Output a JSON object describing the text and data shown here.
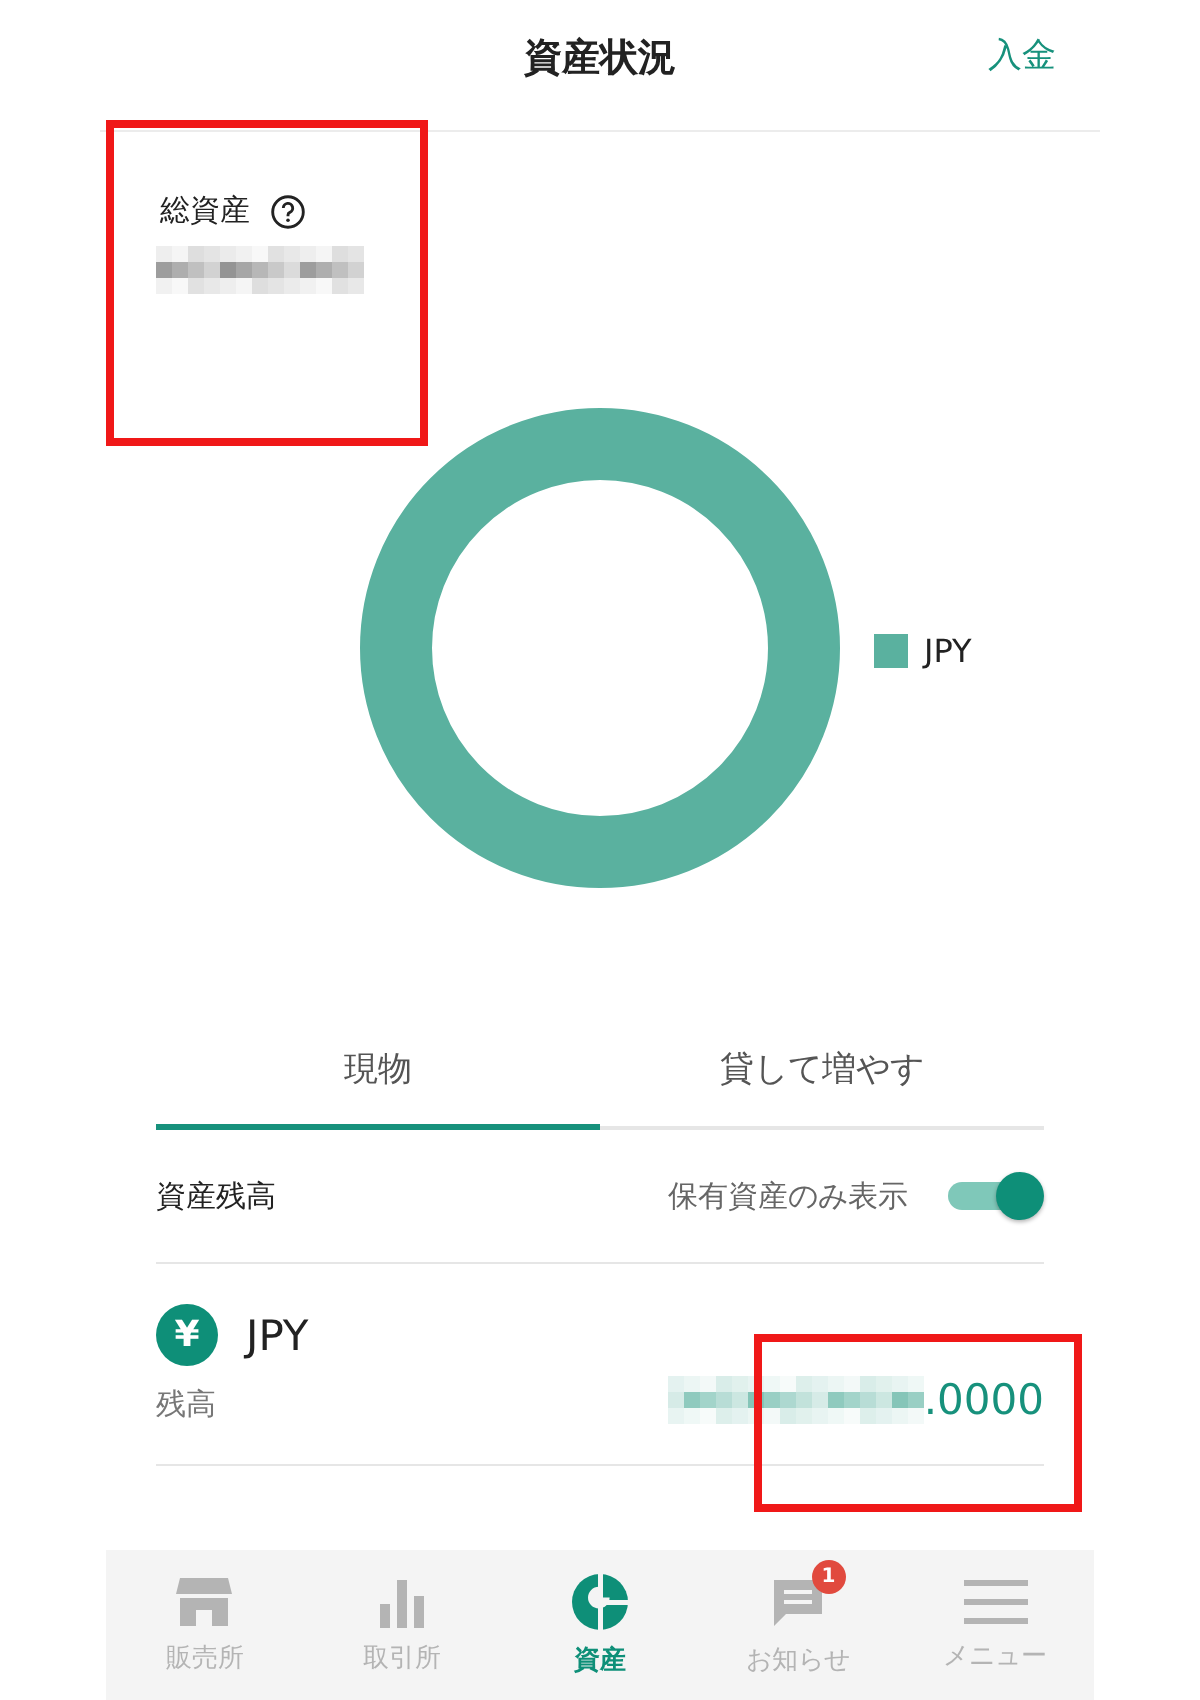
{
  "header": {
    "title": "資産状況",
    "deposit_link": "入金"
  },
  "total_assets": {
    "label": "総資産"
  },
  "legend": [
    {
      "label": "JPY",
      "color": "#5ab19f"
    }
  ],
  "tabs": [
    {
      "label": "現物",
      "selected": true
    },
    {
      "label": "貸して増やす",
      "selected": false
    }
  ],
  "balance_header": {
    "label": "資産残高",
    "filter_label": "保有資産のみ表示",
    "on": true
  },
  "assets": [
    {
      "currency": "JPY",
      "symbol": "¥",
      "label": "残高",
      "value_suffix": ".0000"
    }
  ],
  "nav": [
    {
      "kind": "store",
      "label": "販売所",
      "selected": false
    },
    {
      "kind": "chart",
      "label": "取引所",
      "selected": false
    },
    {
      "kind": "pie",
      "label": "資産",
      "selected": true
    },
    {
      "kind": "message",
      "label": "お知らせ",
      "selected": false,
      "badge": "1"
    },
    {
      "kind": "menu",
      "label": "メニュー",
      "selected": false
    }
  ]
}
